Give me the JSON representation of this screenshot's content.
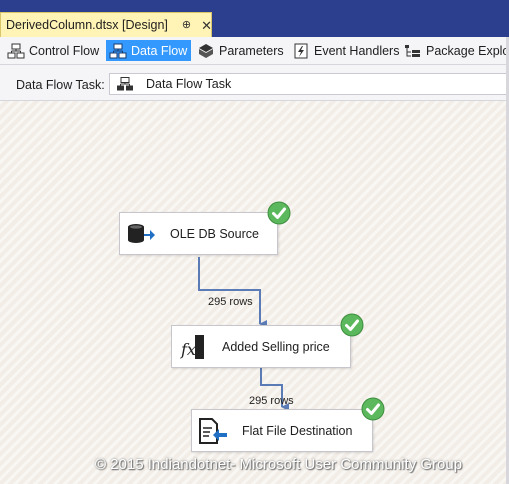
{
  "window": {
    "doc_tab_title": "DerivedColumn.dtsx [Design]",
    "pin_glyph": "⊕",
    "close_glyph": "✕"
  },
  "designer_tabs": [
    {
      "label": "Control Flow",
      "icon": "control-flow-icon",
      "selected": false
    },
    {
      "label": "Data Flow",
      "icon": "data-flow-icon",
      "selected": true
    },
    {
      "label": "Parameters",
      "icon": "parameters-icon",
      "selected": false
    },
    {
      "label": "Event Handlers",
      "icon": "event-handlers-icon",
      "selected": false
    },
    {
      "label": "Package Explor",
      "icon": "package-explorer-icon",
      "selected": false
    }
  ],
  "task_row": {
    "label": "Data Flow Task:",
    "value": "Data Flow Task"
  },
  "components": [
    {
      "label": "OLE DB Source",
      "icon": "ole-db-source-icon",
      "status": "success"
    },
    {
      "label": "Added Selling price",
      "icon": "derived-column-icon",
      "status": "success"
    },
    {
      "label": "Flat File Destination",
      "icon": "flat-file-destination-icon",
      "status": "success"
    }
  ],
  "paths": [
    {
      "rows": "295 rows"
    },
    {
      "rows": "295 rows"
    }
  ],
  "watermark": "© 2015 Indiandotnet- Microsoft User Community Group",
  "colors": {
    "selected_tab": "#3399ff",
    "tab_strip": "#2b3f8e",
    "active_doc_tab": "#fff4b5",
    "success": "#5cb85c",
    "path_line": "#5a7bb5"
  }
}
